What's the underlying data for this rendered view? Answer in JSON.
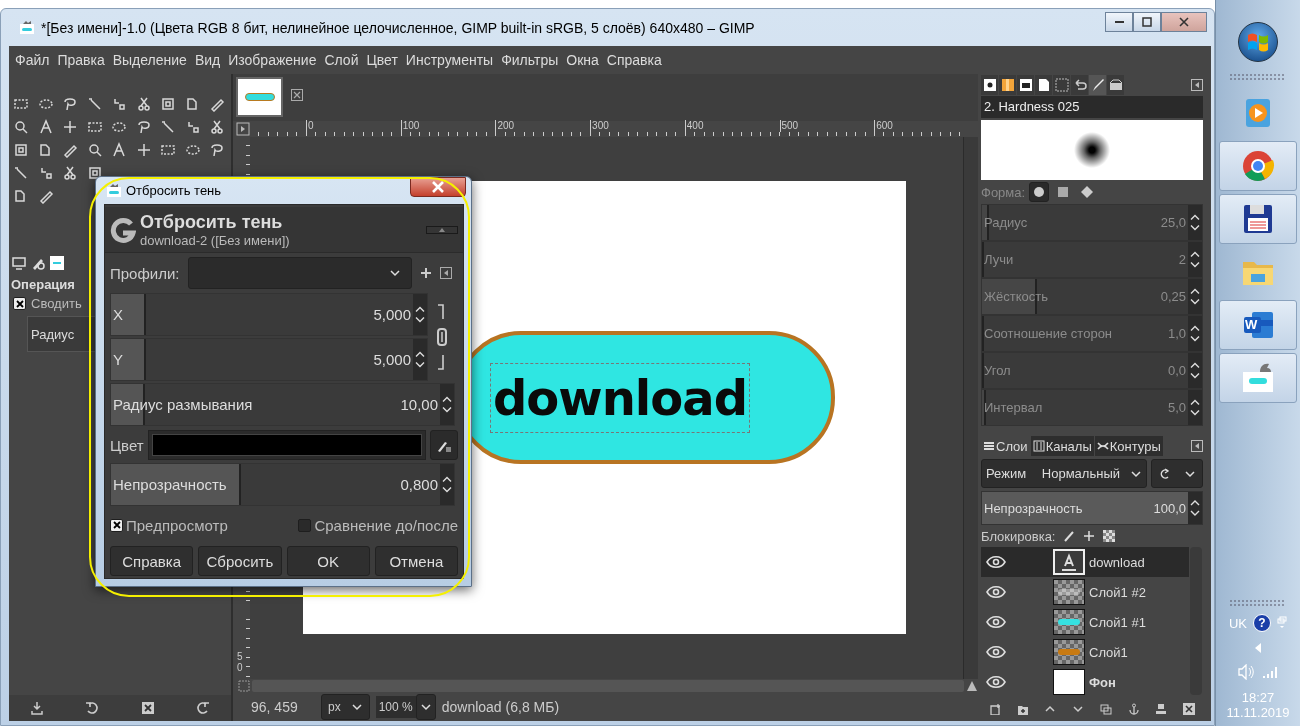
{
  "window": {
    "title": "*[Без имени]-1.0 (Цвета RGB 8 бит, нелинейное целочисленное, GIMP built-in sRGB, 5 слоёв) 640x480 – GIMP"
  },
  "menu": [
    "Файл",
    "Правка",
    "Выделение",
    "Вид",
    "Изображение",
    "Слой",
    "Цвет",
    "Инструменты",
    "Фильтры",
    "Окна",
    "Справка"
  ],
  "tool_options": {
    "title": "Операция",
    "options": [
      {
        "label": "Сводить",
        "checked": true
      }
    ],
    "field": {
      "label": "Радиус"
    }
  },
  "ruler": {
    "h_labels": [
      "0",
      "100",
      "200",
      "300",
      "400",
      "500",
      "600"
    ],
    "v_label": "50"
  },
  "canvas": {
    "text": "download"
  },
  "status_bar": {
    "coords": "96, 459",
    "unit": "px",
    "zoom": "100 %",
    "info": "download (6,8 МБ)"
  },
  "brushes": {
    "tabs": [
      {
        "selected": false
      },
      {
        "selected": false
      },
      {
        "selected": false
      },
      {
        "selected": false
      },
      {
        "selected": false
      },
      {
        "selected": false
      },
      {
        "selected": true
      },
      {
        "selected": false
      }
    ],
    "name": "2. Hardness 025",
    "shape_label": "Форма:",
    "shapes": [
      {
        "selected": true
      },
      {
        "selected": false
      },
      {
        "selected": false
      }
    ],
    "sliders": [
      {
        "label": "Радиус",
        "value": "25,0",
        "level": 0.03,
        "disabled": true
      },
      {
        "label": "Лучи",
        "value": "2",
        "level": 0,
        "disabled": true
      },
      {
        "label": "Жёсткость",
        "value": "0,25",
        "level": 0.25,
        "disabled": true
      },
      {
        "label": "Соотношение сторон",
        "value": "1,0",
        "level": 0,
        "disabled": true
      },
      {
        "label": "Угол",
        "value": "0,0",
        "level": 0,
        "disabled": true
      },
      {
        "label": "Интервал",
        "value": "5,0",
        "level": 0.02,
        "disabled": true
      }
    ]
  },
  "layers": {
    "tabs": [
      {
        "label": "Слои",
        "selected": true
      },
      {
        "label": "Каналы",
        "selected": false
      },
      {
        "label": "Контуры",
        "selected": false
      }
    ],
    "mode_label": "Режим",
    "mode": "Нормальный",
    "opacity": {
      "label": "Непрозрачность",
      "value": "100,0",
      "level": 1
    },
    "lock_label": "Блокировка:",
    "items": [
      {
        "name": "download",
        "kind": "text",
        "selected": true,
        "visible": true,
        "has_alpha": true
      },
      {
        "name": "Слой1 #2",
        "kind": "empty",
        "selected": false,
        "visible": true,
        "has_alpha": true
      },
      {
        "name": "Слой1 #1",
        "kind": "cyan",
        "selected": false,
        "visible": true,
        "has_alpha": true
      },
      {
        "name": "Слой1",
        "kind": "orange",
        "selected": false,
        "visible": true,
        "has_alpha": true
      },
      {
        "name": "Фон",
        "kind": "white",
        "selected": false,
        "visible": true,
        "has_alpha": false
      }
    ]
  },
  "dialog": {
    "title": "Отбросить тень",
    "heading": "Отбросить тень",
    "subtitle": "download-2 ([Без имени])",
    "profiles_label": "Профили:",
    "offset": {
      "linked": true,
      "fields": [
        {
          "label": "X",
          "value": "5,000",
          "level": 0.11
        },
        {
          "label": "Y",
          "value": "5,000",
          "level": 0.11
        }
      ]
    },
    "fields": [
      {
        "kind": "spin",
        "label": "Радиус размывания",
        "value": "10,00",
        "level": 0.1
      },
      {
        "kind": "color",
        "label": "Цвет",
        "color": "#000000"
      },
      {
        "kind": "spin",
        "label": "Непрозрачность",
        "value": "0,800",
        "level": 0.38
      }
    ],
    "checks": [
      {
        "label": "Предпросмотр",
        "checked": true
      },
      {
        "label": "Сравнение до/после",
        "checked": false
      }
    ],
    "buttons": [
      "Справка",
      "Сбросить",
      "OK",
      "Отмена"
    ]
  },
  "taskbar": {
    "apps": [
      {
        "kind": "media",
        "running": false
      },
      {
        "kind": "chrome",
        "running": true
      },
      {
        "kind": "floppy",
        "running": true
      },
      {
        "kind": "folder",
        "running": false
      },
      {
        "kind": "word",
        "running": true,
        "label": "W"
      },
      {
        "kind": "gimp",
        "running": true
      }
    ],
    "lang": "UK",
    "help": "?",
    "time": "18:27",
    "date": "11.11.2019"
  }
}
